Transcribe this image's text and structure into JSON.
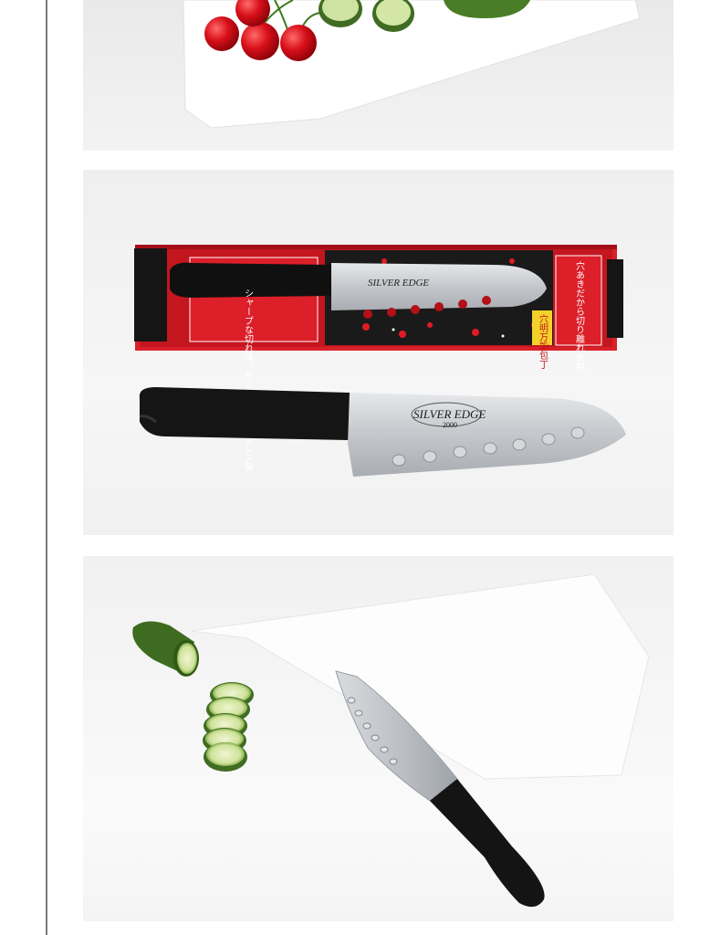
{
  "product": {
    "brand": "SILVER EDGE",
    "model": "2000",
    "box_tag_main": "穴明万能包丁",
    "box_tag_side": "穴あきだから切り離れ抜群。",
    "box_feature": "シャープな切れ味。サビに強いステンレス製"
  },
  "colors": {
    "box_red": "#d9212a",
    "handle_black": "#161616",
    "blade_steel": "#c9ccd0",
    "cucumber": "#5f8f2e"
  }
}
